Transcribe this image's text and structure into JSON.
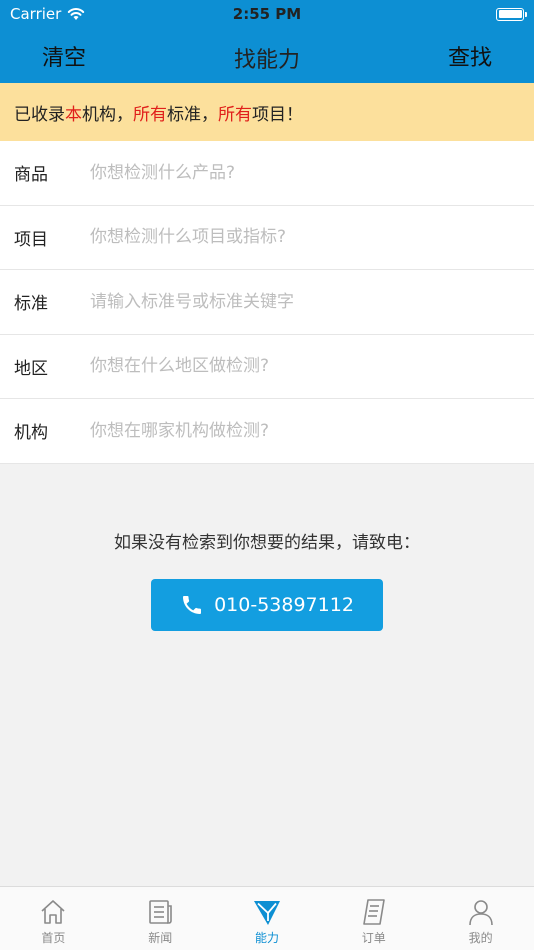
{
  "status": {
    "carrier": "Carrier",
    "time": "2:55 PM"
  },
  "nav": {
    "left": "清空",
    "title": "找能力",
    "right": "查找"
  },
  "notice": {
    "p1": "已收录",
    "r1": "本",
    "p2": "机构，",
    "r2": "所有",
    "p3": "标准，",
    "r3": "所有",
    "p4": "项目！"
  },
  "form": {
    "rows": [
      {
        "label": "商品",
        "placeholder": "你想检测什么产品?"
      },
      {
        "label": "项目",
        "placeholder": "你想检测什么项目或指标?"
      },
      {
        "label": "标准",
        "placeholder": "请输入标准号或标准关键字"
      },
      {
        "label": "地区",
        "placeholder": "你想在什么地区做检测?"
      },
      {
        "label": "机构",
        "placeholder": "你想在哪家机构做检测?"
      }
    ]
  },
  "help": {
    "text": "如果没有检索到你想要的结果，请致电：",
    "phone": "010-53897112"
  },
  "tabs": [
    {
      "label": "首页",
      "icon": "home-icon"
    },
    {
      "label": "新闻",
      "icon": "news-icon"
    },
    {
      "label": "能力",
      "icon": "ability-icon"
    },
    {
      "label": "订单",
      "icon": "order-icon"
    },
    {
      "label": "我的",
      "icon": "profile-icon"
    }
  ],
  "colors": {
    "primary": "#0d8fd3",
    "notice_bg": "#fce09c",
    "highlight": "#e0201b",
    "phone_button": "#139ee0"
  }
}
